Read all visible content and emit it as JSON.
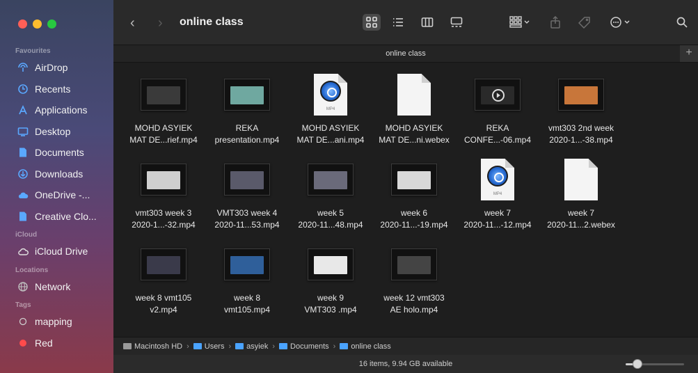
{
  "window": {
    "title": "online class",
    "tab_title": "online class"
  },
  "sidebar": {
    "favourites_label": "Favourites",
    "favourites": [
      {
        "label": "AirDrop",
        "icon": "airdrop-icon",
        "color": "#5aa8ff"
      },
      {
        "label": "Recents",
        "icon": "clock-icon",
        "color": "#5aa8ff"
      },
      {
        "label": "Applications",
        "icon": "applications-icon",
        "color": "#5aa8ff"
      },
      {
        "label": "Desktop",
        "icon": "desktop-icon",
        "color": "#5aa8ff"
      },
      {
        "label": "Documents",
        "icon": "document-icon",
        "color": "#5aa8ff"
      },
      {
        "label": "Downloads",
        "icon": "download-icon",
        "color": "#5aa8ff"
      },
      {
        "label": "OneDrive -...",
        "icon": "cloud-icon",
        "color": "#5aa8ff"
      },
      {
        "label": "Creative Clo...",
        "icon": "file-icon",
        "color": "#5aa8ff"
      }
    ],
    "icloud_label": "iCloud",
    "icloud": [
      {
        "label": "iCloud Drive",
        "icon": "icloud-icon"
      }
    ],
    "locations_label": "Locations",
    "locations": [
      {
        "label": "Network",
        "icon": "globe-icon"
      }
    ],
    "tags_label": "Tags",
    "tags": [
      {
        "label": "mapping",
        "icon": "tag-circle-icon"
      },
      {
        "label": "Red",
        "icon": "tag-red-icon",
        "color": "#ff4b4b"
      }
    ]
  },
  "files": [
    {
      "line1": "MOHD ASYIEK",
      "line2": "MAT DE...rief.mp4",
      "kind": "video",
      "screen": "#3a3a3a"
    },
    {
      "line1": "REKA",
      "line2": "presentation.mp4",
      "kind": "video",
      "screen": "#6fa8a0"
    },
    {
      "line1": "MOHD ASYIEK",
      "line2": "MAT DE...ani.mp4",
      "kind": "mp4doc",
      "badge_text": "MP4"
    },
    {
      "line1": "MOHD ASYIEK",
      "line2": "MAT DE...ni.webex",
      "kind": "doc"
    },
    {
      "line1": "REKA",
      "line2": "CONFE...-06.mp4",
      "kind": "play",
      "screen": "#2a2a2a"
    },
    {
      "line1": "vmt303 2nd week",
      "line2": "2020-1...-38.mp4",
      "kind": "video",
      "screen": "#c8763a"
    },
    {
      "line1": "vmt303 week 3",
      "line2": "2020-1...-32.mp4",
      "kind": "video",
      "screen": "#cfcfcf"
    },
    {
      "line1": "VMT303 week 4",
      "line2": "2020-11...53.mp4",
      "kind": "video",
      "screen": "#5a5a6a"
    },
    {
      "line1": "week 5",
      "line2": "2020-11...48.mp4",
      "kind": "video",
      "screen": "#6a6a7a"
    },
    {
      "line1": "week 6",
      "line2": "2020-11...-19.mp4",
      "kind": "video",
      "screen": "#d8d8d8"
    },
    {
      "line1": "week 7",
      "line2": "2020-11...-12.mp4",
      "kind": "mp4doc",
      "badge_text": "MP4"
    },
    {
      "line1": "week 7",
      "line2": "2020-11...2.webex",
      "kind": "doc"
    },
    {
      "line1": "week 8 vmt105",
      "line2": "v2.mp4",
      "kind": "video",
      "screen": "#3a3a4a"
    },
    {
      "line1": "week 8",
      "line2": "vmt105.mp4",
      "kind": "video",
      "screen": "#2f5f9a"
    },
    {
      "line1": "week 9",
      "line2": "VMT303 .mp4",
      "kind": "video",
      "screen": "#e8e8e8"
    },
    {
      "line1": "week 12 vmt303",
      "line2": "AE holo.mp4",
      "kind": "video",
      "screen": "#444"
    }
  ],
  "pathbar": [
    {
      "label": "Macintosh HD",
      "color": "#9a9a9a"
    },
    {
      "label": "Users",
      "color": "#4aa3ff"
    },
    {
      "label": "asyiek",
      "color": "#4aa3ff"
    },
    {
      "label": "Documents",
      "color": "#4aa3ff"
    },
    {
      "label": "online class",
      "color": "#4aa3ff"
    }
  ],
  "status": {
    "text": "16 items, 9.94 GB available",
    "zoom_level": 0.2
  }
}
